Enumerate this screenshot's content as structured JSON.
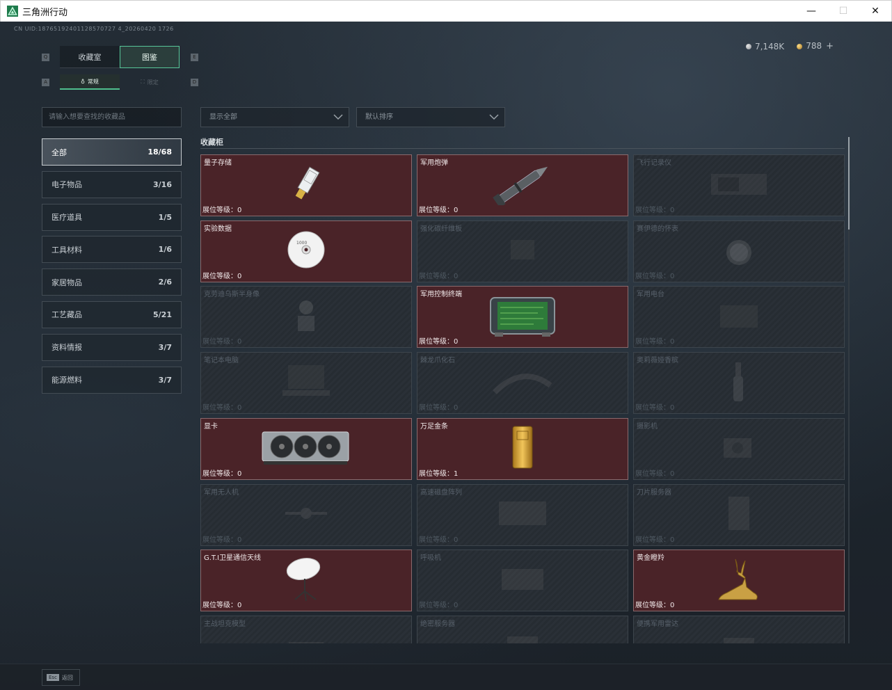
{
  "window": {
    "title": "三角洲行动",
    "minimize": "—",
    "maximize": "☐",
    "close": "✕"
  },
  "uid": "CN UID:18765192401128570727 4_20260420 1726",
  "currency": {
    "silver": "7,148K",
    "gold": "788",
    "plus": "+"
  },
  "keys": {
    "q": "Q",
    "e": "E",
    "a": "A",
    "d": "D"
  },
  "main_tabs": [
    "收藏室",
    "图鉴"
  ],
  "sub_tabs": [
    "常规",
    "限定"
  ],
  "search": {
    "placeholder": "请输入想要查找的收藏品"
  },
  "filters": {
    "show": "显示全部",
    "sort": "默认排序"
  },
  "categories": [
    {
      "label": "全部",
      "count": "18/68"
    },
    {
      "label": "电子物品",
      "count": "3/16"
    },
    {
      "label": "医疗道具",
      "count": "1/5"
    },
    {
      "label": "工具材料",
      "count": "1/6"
    },
    {
      "label": "家居物品",
      "count": "2/6"
    },
    {
      "label": "工艺藏品",
      "count": "5/21"
    },
    {
      "label": "资料情报",
      "count": "3/7"
    },
    {
      "label": "能源燃料",
      "count": "3/7"
    }
  ],
  "section_title": "收藏柜",
  "level_prefix": "展位等级：",
  "items": [
    {
      "name": "量子存储",
      "level": "0",
      "owned": true,
      "icon": "usb-drive-icon"
    },
    {
      "name": "军用炮弹",
      "level": "0",
      "owned": true,
      "icon": "artillery-shell-icon"
    },
    {
      "name": "飞行记录仪",
      "level": "0",
      "owned": false,
      "icon": "flight-recorder-icon"
    },
    {
      "name": "实验数据",
      "level": "0",
      "owned": true,
      "icon": "cd-disc-icon"
    },
    {
      "name": "强化碳纤维板",
      "level": "0",
      "owned": false,
      "icon": "carbon-plate-icon"
    },
    {
      "name": "赛伊德的怀表",
      "level": "0",
      "owned": false,
      "icon": "pocket-watch-icon"
    },
    {
      "name": "克劳迪乌斯半身像",
      "level": "0",
      "owned": false,
      "icon": "bust-statue-icon"
    },
    {
      "name": "军用控制终端",
      "level": "0",
      "owned": true,
      "icon": "control-terminal-icon"
    },
    {
      "name": "军用电台",
      "level": "0",
      "owned": false,
      "icon": "military-radio-icon"
    },
    {
      "name": "笔记本电脑",
      "level": "0",
      "owned": false,
      "icon": "laptop-icon"
    },
    {
      "name": "棘龙爪化石",
      "level": "0",
      "owned": false,
      "icon": "claw-fossil-icon"
    },
    {
      "name": "奥莉薇娅香槟",
      "level": "0",
      "owned": false,
      "icon": "champagne-icon"
    },
    {
      "name": "显卡",
      "level": "0",
      "owned": true,
      "icon": "graphics-card-icon"
    },
    {
      "name": "万足金条",
      "level": "1",
      "owned": true,
      "icon": "gold-bar-icon"
    },
    {
      "name": "摄影机",
      "level": "0",
      "owned": false,
      "icon": "camera-icon"
    },
    {
      "name": "军用无人机",
      "level": "0",
      "owned": false,
      "icon": "drone-icon"
    },
    {
      "name": "高速磁盘阵列",
      "level": "0",
      "owned": false,
      "icon": "disk-array-icon"
    },
    {
      "name": "刀片服务器",
      "level": "0",
      "owned": false,
      "icon": "blade-server-icon"
    },
    {
      "name": "G.T.I卫星通信天线",
      "level": "0",
      "owned": true,
      "icon": "satellite-dish-icon"
    },
    {
      "name": "呼吸机",
      "level": "0",
      "owned": false,
      "icon": "ventilator-icon"
    },
    {
      "name": "黄金瞪羚",
      "level": "0",
      "owned": true,
      "icon": "gold-gazelle-icon"
    },
    {
      "name": "主战坦克模型",
      "level": "",
      "owned": false,
      "icon": "tank-model-icon"
    },
    {
      "name": "绝密服务器",
      "level": "",
      "owned": false,
      "icon": "server-icon"
    },
    {
      "name": "便携军用雷达",
      "level": "",
      "owned": false,
      "icon": "radar-icon"
    }
  ],
  "bottom": {
    "esc_key": "Esc",
    "esc_label": "返回"
  }
}
